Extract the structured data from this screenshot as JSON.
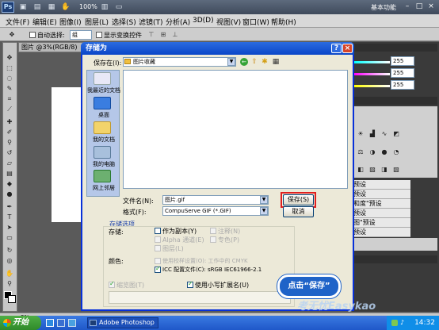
{
  "app": {
    "logo": "Ps",
    "zoom": "100%",
    "workspace_label": "基本功能",
    "win_buttons": [
      "–",
      "□",
      "×"
    ]
  },
  "menu": [
    "文件(F)",
    "编辑(E)",
    "图像(I)",
    "图层(L)",
    "选择(S)",
    "滤镜(T)",
    "分析(A)",
    "3D(D)",
    "视图(V)",
    "窗口(W)",
    "帮助(H)"
  ],
  "options_bar": {
    "auto_select_label": "自动选择:",
    "auto_select_value": "组",
    "show_transform_label": "显示变换控件"
  },
  "document": {
    "tab_label": "图片 @3%(RGB/8)"
  },
  "right_panel": {
    "color_values": [
      "255",
      "255",
      "255"
    ],
    "presets": [
      "预设",
      "预设",
      "和度\"预设",
      "预设",
      "图\"预设",
      "预设"
    ]
  },
  "status": {
    "zoom": "3%"
  },
  "taskbar": {
    "start_label": "开始",
    "task_label": "Adobe Photoshop ...",
    "clock": "14:32"
  },
  "dialog": {
    "title": "存储为",
    "save_in_label": "保存在(I):",
    "save_in_value": "图片收藏",
    "places": [
      "我最近的文档",
      "桌面",
      "我的文档",
      "我的电脑",
      "网上邻居"
    ],
    "filename_label": "文件名(N):",
    "filename_value": "图片.gif",
    "format_label": "格式(F):",
    "format_value": "CompuServe GIF (*.GIF)",
    "save_button": "保存(S)",
    "cancel_button": "取消",
    "options_title": "存储选项",
    "storage_label": "存储:",
    "options": {
      "as_copy": "作为副本(Y)",
      "notes": "注释(N)",
      "alpha": "Alpha 通道(E)",
      "spot": "专色(P)",
      "layers": "图层(L)"
    },
    "color_label": "颜色:",
    "proof_setup": "使用校样设置(O): 工作中的 CMYK",
    "icc_profile": "ICC 配置文件(C): sRGB IEC61966-2.1",
    "thumbnail": "缩览图(T)",
    "lowercase_ext": "使用小写扩展名(U)"
  },
  "callout": {
    "text": "点击“保存”"
  },
  "watermark": "考无忧Easykao",
  "colors": {
    "title_blue": "#0a46c8",
    "highlight_red": "#e02020",
    "callout_blue": "#1f63c8"
  }
}
